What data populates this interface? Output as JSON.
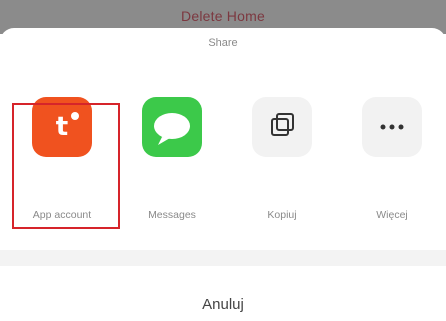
{
  "background": {
    "title": "Delete Home"
  },
  "sheet": {
    "title": "Share",
    "items": [
      {
        "label": "App account",
        "icon": "tuya-app-icon",
        "color": "#f0521f"
      },
      {
        "label": "Messages",
        "icon": "messages-icon",
        "color": "#3cc94a"
      },
      {
        "label": "Kopiuj",
        "icon": "copy-icon",
        "color": "#f2f2f2"
      },
      {
        "label": "Więcej",
        "icon": "more-icon",
        "color": "#f2f2f2"
      }
    ],
    "highlight_color": "#d6242a"
  },
  "cancel": {
    "label": "Anuluj"
  }
}
